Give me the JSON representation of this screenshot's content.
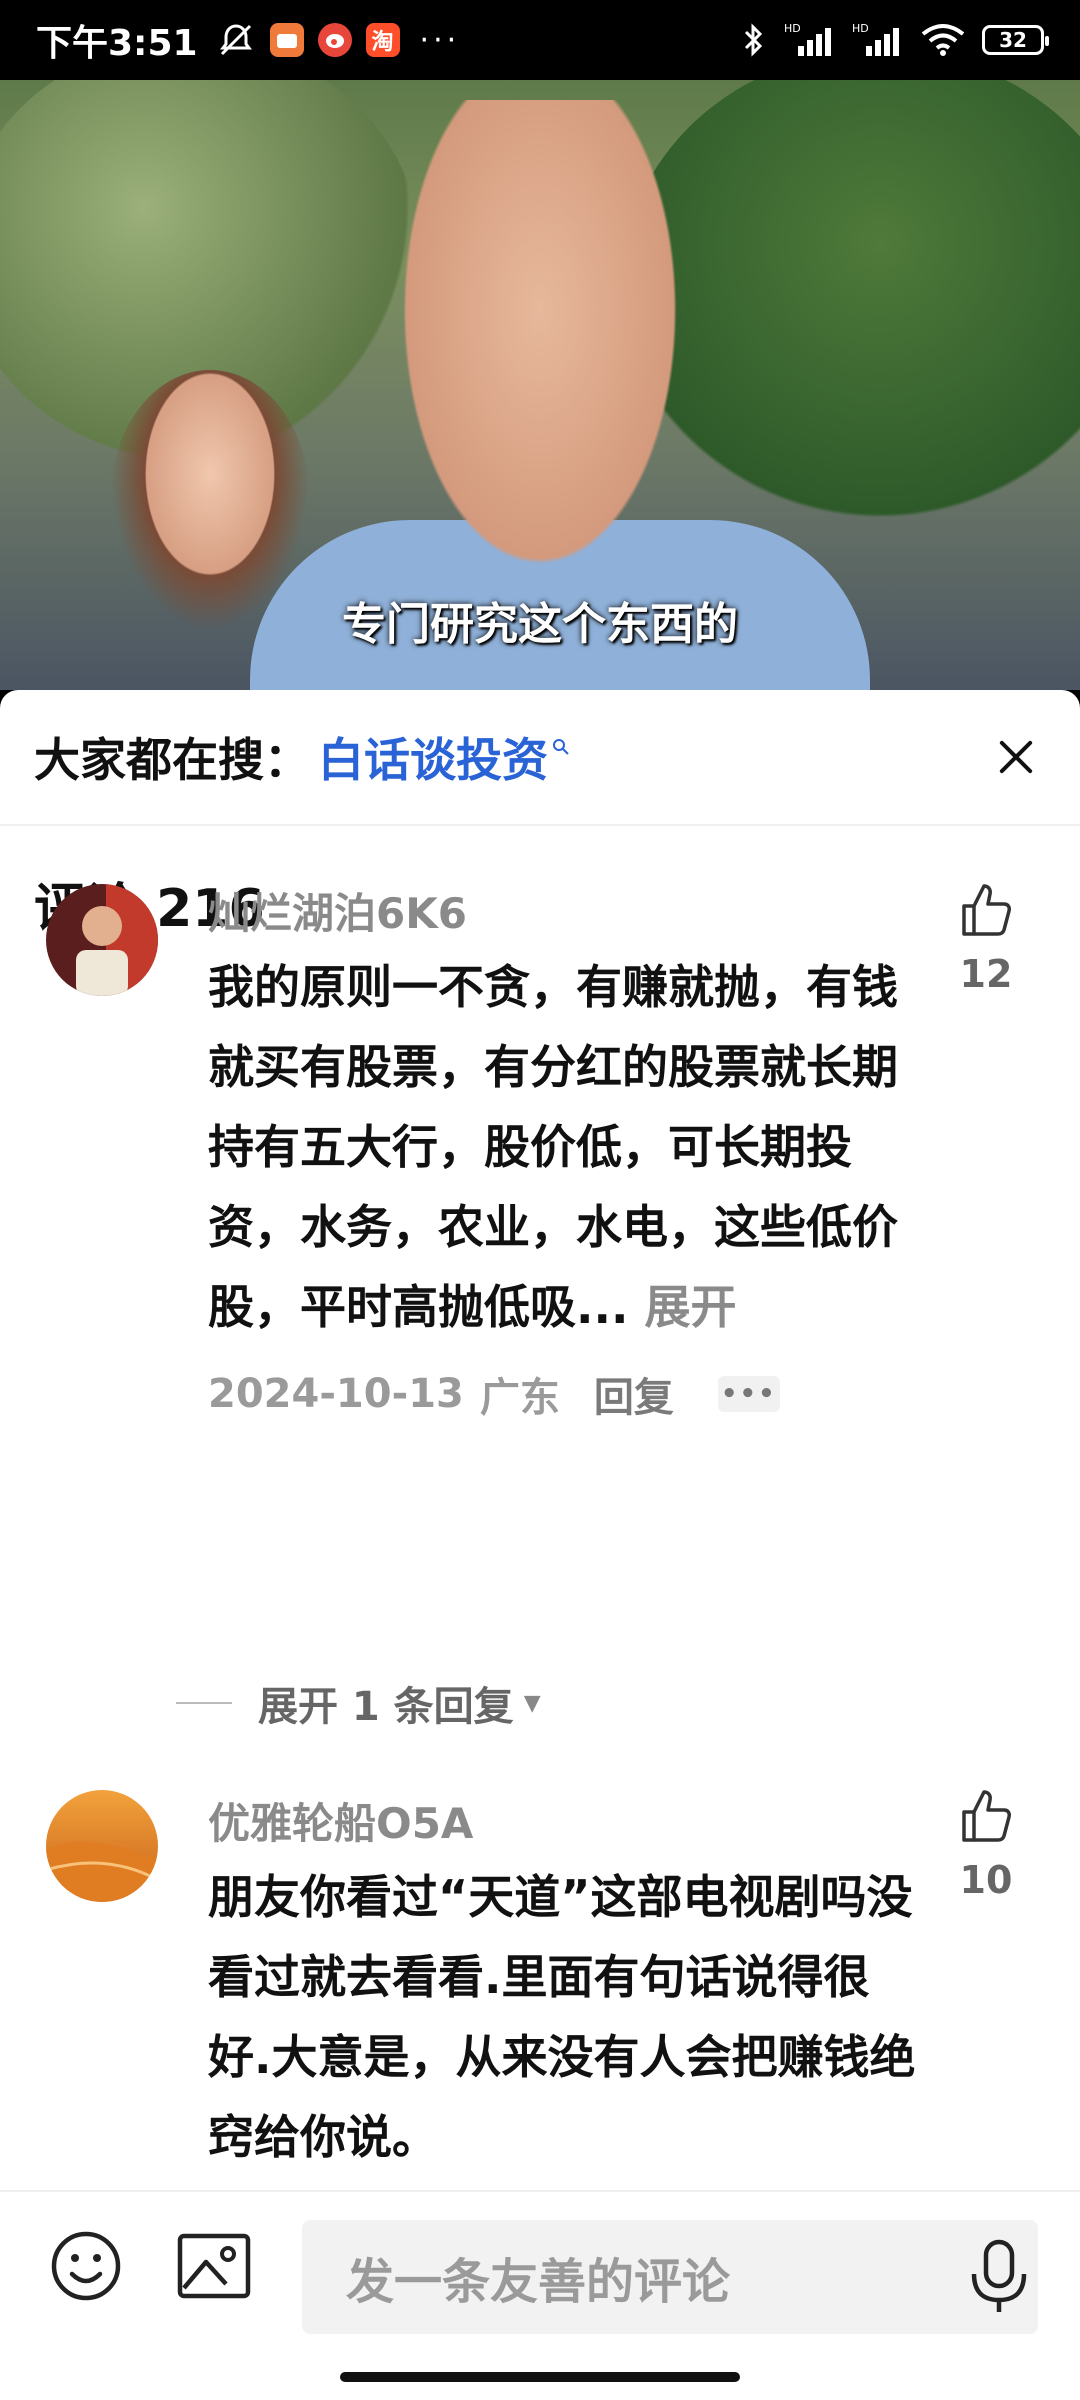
{
  "status_bar": {
    "time": "下午3:51",
    "app_taobao": "淘",
    "more": "···",
    "battery": "32"
  },
  "video": {
    "subtitle": "专门研究这个东西的"
  },
  "search": {
    "prefix": "大家都在搜：",
    "term": "白话谈投资"
  },
  "comments": {
    "title": "评论 216",
    "items": [
      {
        "user": "灿烂湖泊6K6",
        "text": "我的原则一不贪，有赚就抛，有钱就买有股票，有分红的股票就长期持有五大行，股价低，可长期投资，水务，农业，水电，这些低价股，平时高抛低吸...",
        "expand": "展开",
        "date": "2024-10-13",
        "location": "广东",
        "reply": "回复",
        "likes": "12",
        "expand_replies": "展开 1 条回复"
      },
      {
        "user": "优雅轮船O5A",
        "text": "朋友你看过“天道”这部电视剧吗没看过就去看看.里面有句话说得很好.大意是，从来没有人会把赚钱绝窍给你说。",
        "likes": "10"
      }
    ]
  },
  "bottom_bar": {
    "placeholder": "发一条友善的评论"
  },
  "colors": {
    "link_blue": "#2a63d6",
    "muted_text": "#8a8a8a"
  }
}
